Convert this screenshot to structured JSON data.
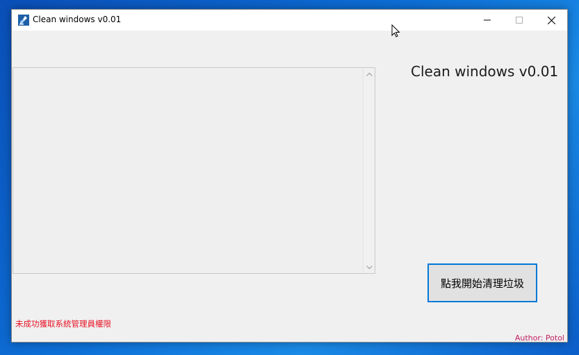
{
  "window": {
    "title": "Clean windows v0.01",
    "minimize_icon": "minimize-icon",
    "maximize_icon": "maximize-icon",
    "close_icon": "close-icon"
  },
  "main": {
    "heading": "Clean windows v0.01",
    "log_text": "",
    "clean_button_label": "點我開始清理垃圾",
    "status_message": "未成功獲取系統管理員權限",
    "author": "Author: Potol"
  },
  "colors": {
    "status_message": "#e81123",
    "author": "#c02060",
    "button_border": "#0078d7",
    "window_background": "#f0f0f0"
  }
}
